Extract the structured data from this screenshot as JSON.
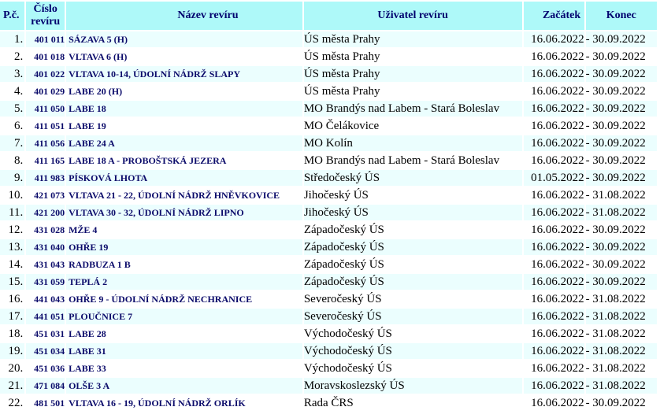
{
  "header": {
    "pc": "P.č.",
    "cislo_line1": "Číslo",
    "cislo_line2": "revíru",
    "nazev": "Název revíru",
    "uzivatel": "Uživatel revíru",
    "zacatek": "Začátek",
    "konec": "Konec"
  },
  "rows": [
    {
      "pc": "1.",
      "cislo": "401 011",
      "nazev": "SÁZAVA 5 (H)",
      "uzivatel": "ÚS města Prahy",
      "zacatek": "16.06.2022",
      "konec": "- 30.09.2022"
    },
    {
      "pc": "2.",
      "cislo": "401 018",
      "nazev": "VLTAVA 6 (H)",
      "uzivatel": "ÚS města Prahy",
      "zacatek": "16.06.2022",
      "konec": "- 30.09.2022"
    },
    {
      "pc": "3.",
      "cislo": "401 022",
      "nazev": "VLTAVA 10-14, ÚDOLNÍ NÁDRŽ SLAPY",
      "uzivatel": "ÚS města Prahy",
      "zacatek": "16.06.2022",
      "konec": "- 30.09.2022"
    },
    {
      "pc": "4.",
      "cislo": "401 029",
      "nazev": "LABE 20 (H)",
      "uzivatel": "ÚS města Prahy",
      "zacatek": "16.06.2022",
      "konec": "- 30.09.2022"
    },
    {
      "pc": "5.",
      "cislo": "411 050",
      "nazev": "LABE 18",
      "uzivatel": "MO Brandýs nad Labem - Stará Boleslav",
      "zacatek": "16.06.2022",
      "konec": "- 30.09.2022"
    },
    {
      "pc": "6.",
      "cislo": "411 051",
      "nazev": "LABE 19",
      "uzivatel": "MO Čelákovice",
      "zacatek": "16.06.2022",
      "konec": "- 30.09.2022"
    },
    {
      "pc": "7.",
      "cislo": "411 056",
      "nazev": "LABE 24 A",
      "uzivatel": "MO Kolín",
      "zacatek": "16.06.2022",
      "konec": "- 30.09.2022"
    },
    {
      "pc": "8.",
      "cislo": "411 165",
      "nazev": "LABE 18 A - PROBOŠTSKÁ JEZERA",
      "uzivatel": "MO Brandýs nad Labem - Stará Boleslav",
      "zacatek": "16.06.2022",
      "konec": "- 30.09.2022"
    },
    {
      "pc": "9.",
      "cislo": "411 983",
      "nazev": "PÍSKOVÁ LHOTA",
      "uzivatel": "Středočeský ÚS",
      "zacatek": "01.05.2022",
      "konec": "- 30.09.2022"
    },
    {
      "pc": "10.",
      "cislo": "421 073",
      "nazev": "VLTAVA 21 - 22, ÚDOLNÍ NÁDRŽ HNĚVKOVICE",
      "uzivatel": "Jihočeský ÚS",
      "zacatek": "16.06.2022",
      "konec": "- 31.08.2022"
    },
    {
      "pc": "11.",
      "cislo": "421 200",
      "nazev": "VLTAVA 30 - 32, ÚDOLNÍ NÁDRŽ LIPNO",
      "uzivatel": "Jihočeský ÚS",
      "zacatek": "16.06.2022",
      "konec": "- 31.08.2022"
    },
    {
      "pc": "12.",
      "cislo": "431 028",
      "nazev": "MŽE 4",
      "uzivatel": "Západočeský ÚS",
      "zacatek": "16.06.2022",
      "konec": "- 30.09.2022"
    },
    {
      "pc": "13.",
      "cislo": "431 040",
      "nazev": "OHŘE 19",
      "uzivatel": "Západočeský ÚS",
      "zacatek": "16.06.2022",
      "konec": "- 30.09.2022"
    },
    {
      "pc": "14.",
      "cislo": "431 043",
      "nazev": "RADBUZA 1 B",
      "uzivatel": "Západočeský ÚS",
      "zacatek": "16.06.2022",
      "konec": "- 30.09.2022"
    },
    {
      "pc": "15.",
      "cislo": "431 059",
      "nazev": "TEPLÁ 2",
      "uzivatel": "Západočeský ÚS",
      "zacatek": "16.06.2022",
      "konec": "- 30.09.2022"
    },
    {
      "pc": "16.",
      "cislo": "441 043",
      "nazev": "OHŘE 9 - ÚDOLNÍ NÁDRŽ NECHRANICE",
      "uzivatel": "Severočeský ÚS",
      "zacatek": "16.06.2022",
      "konec": "- 31.08.2022"
    },
    {
      "pc": "17.",
      "cislo": "441 051",
      "nazev": "PLOUČNICE 7",
      "uzivatel": "Severočeský ÚS",
      "zacatek": "16.06.2022",
      "konec": "- 31.08.2022"
    },
    {
      "pc": "18.",
      "cislo": "451 031",
      "nazev": "LABE 28",
      "uzivatel": "Východočeský ÚS",
      "zacatek": "16.06.2022",
      "konec": "- 31.08.2022"
    },
    {
      "pc": "19.",
      "cislo": "451 034",
      "nazev": "LABE 31",
      "uzivatel": "Východočeský ÚS",
      "zacatek": "16.06.2022",
      "konec": "- 31.08.2022"
    },
    {
      "pc": "20.",
      "cislo": "451 036",
      "nazev": "LABE 33",
      "uzivatel": "Východočeský ÚS",
      "zacatek": "16.06.2022",
      "konec": "- 31.08.2022"
    },
    {
      "pc": "21.",
      "cislo": "471 084",
      "nazev": "OLŠE 3 A",
      "uzivatel": "Moravskoslezský ÚS",
      "zacatek": "16.06.2022",
      "konec": "- 31.08.2022"
    },
    {
      "pc": "22.",
      "cislo": "481 501",
      "nazev": "VLTAVA 16 - 19, ÚDOLNÍ NÁDRŽ ORLÍK",
      "uzivatel": "Rada ČRS",
      "zacatek": "16.06.2022",
      "konec": "- 30.09.2022"
    }
  ]
}
